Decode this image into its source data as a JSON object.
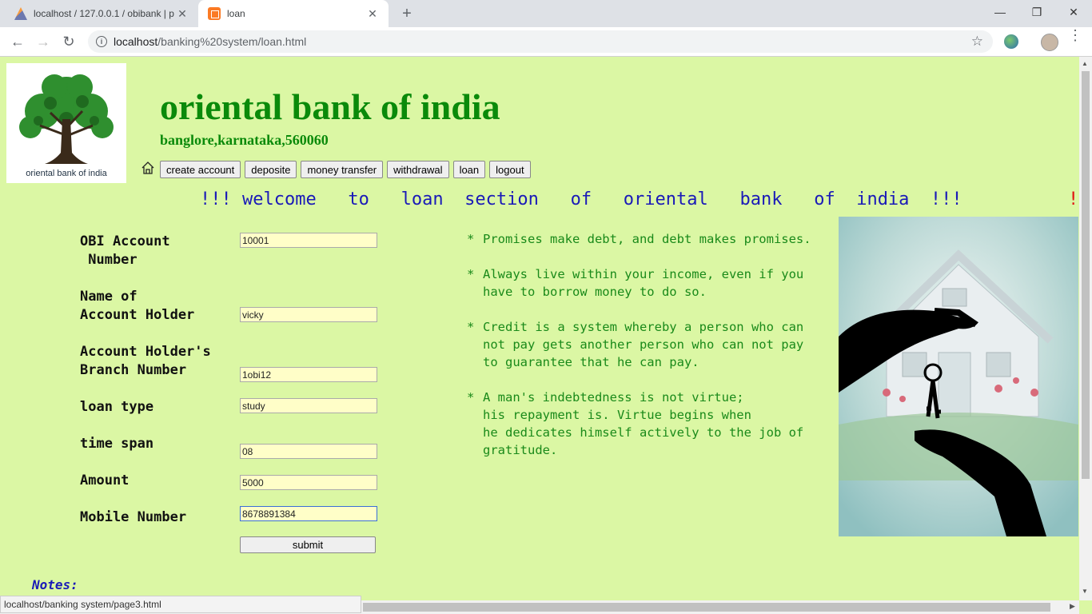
{
  "browser": {
    "tabs": [
      {
        "title": "localhost / 127.0.0.1 / obibank | p",
        "icon": "phpmyadmin-icon"
      },
      {
        "title": "loan",
        "icon": "xampp-icon"
      }
    ],
    "url_host": "localhost",
    "url_path": "/banking%20system/loan.html",
    "status_url": "localhost/banking system/page3.html"
  },
  "header": {
    "logo_caption": "oriental bank of india",
    "bank_name": "oriental bank of india",
    "address": "banglore,karnataka,560060",
    "nav": [
      "create account",
      "deposite",
      "money transfer",
      "withdrawal",
      "loan",
      "logout"
    ]
  },
  "marquee": {
    "text": "!!! welcome   to   loan  section   of   oriental   bank   of  india  !!!",
    "tail": "!"
  },
  "form": {
    "account_label": "OBI Account\n Number",
    "account_value": "10001",
    "holder_label": "Name of\nAccount Holder",
    "holder_value": "vicky",
    "branch_label": "Account Holder's\nBranch Number",
    "branch_value": "1obi12",
    "loan_type_label": "loan type",
    "loan_type_value": "study",
    "time_span_label": "time span",
    "time_span_value": "08",
    "amount_label": "Amount",
    "amount_value": "5000",
    "mobile_label": "Mobile Number",
    "mobile_value": "8678891384",
    "submit_label": "submit"
  },
  "quotes": [
    "Promises make debt, and debt makes promises.",
    "Always live within your income, even if you\nhave to borrow money to do so.",
    "Credit is a system whereby a person who can\nnot pay gets another person who can not pay\nto guarantee that he can pay.",
    "A man's indebtedness is not virtue;\nhis repayment is. Virtue begins when\nhe dedicates himself actively to the job of\ngratitude."
  ],
  "notes_label": "Notes:"
}
